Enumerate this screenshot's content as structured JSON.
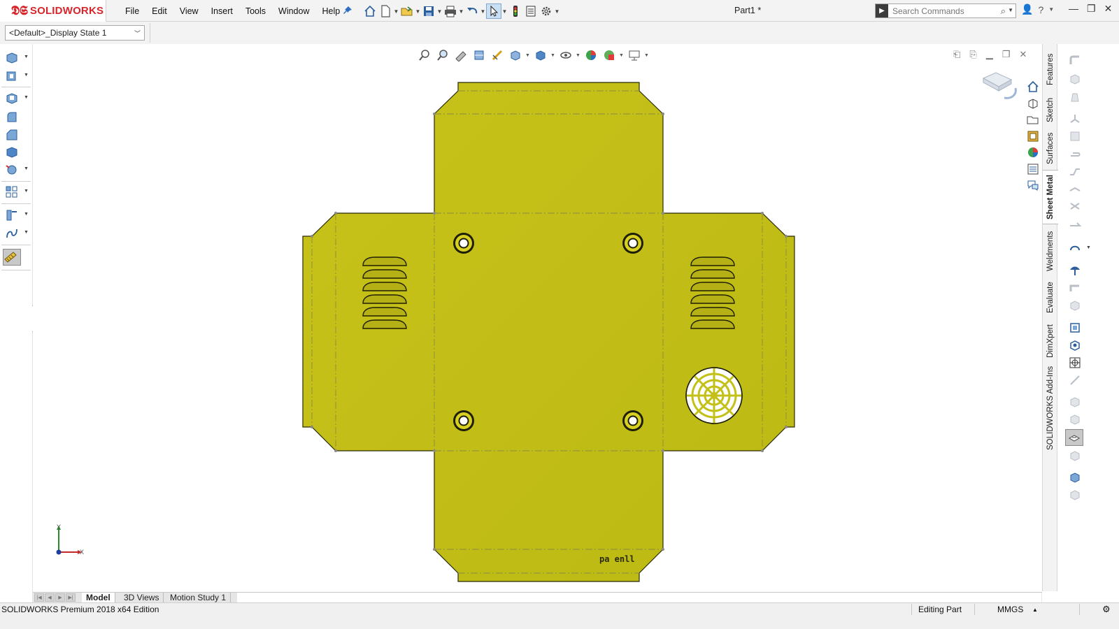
{
  "app": {
    "name": "SOLIDWORKS",
    "document_title": "Part1 *",
    "brand_color": "#d7262b"
  },
  "menu": {
    "items": [
      "File",
      "Edit",
      "View",
      "Insert",
      "Tools",
      "Window",
      "Help"
    ]
  },
  "search": {
    "placeholder": "Search Commands"
  },
  "display_state": {
    "value": "<Default>_Display State 1"
  },
  "command_tabs": [
    "Features",
    "Sketch",
    "Surfaces",
    "Sheet Metal",
    "Weldments",
    "Evaluate",
    "DimXpert",
    "SOLIDWORKS Add-Ins"
  ],
  "active_command_tab": "Sheet Metal",
  "bottom_tabs": [
    "Model",
    "3D Views",
    "Motion Study 1"
  ],
  "active_bottom_tab": "Model",
  "status": {
    "edition": "SOLIDWORKS Premium 2018 x64 Edition",
    "mode": "Editing Part",
    "units": "MMGS"
  },
  "triad": {
    "x_label": "X",
    "y_label": "Y"
  },
  "model": {
    "part_color": "#c3c018",
    "edge_color": "#2a2a08",
    "engraved_text": "pa enll"
  },
  "icons": {
    "toolbar": [
      "home-icon",
      "new-document-icon",
      "open-folder-icon",
      "save-icon",
      "print-icon",
      "undo-icon",
      "select-arrow-icon",
      "rebuild-traffic-light-icon",
      "file-properties-icon",
      "options-gear-icon"
    ],
    "task_pane": [
      "solidworks-resources-icon",
      "design-library-icon",
      "file-explorer-icon",
      "view-palette-icon",
      "appearances-icon",
      "custom-properties-icon",
      "forum-icon"
    ]
  }
}
